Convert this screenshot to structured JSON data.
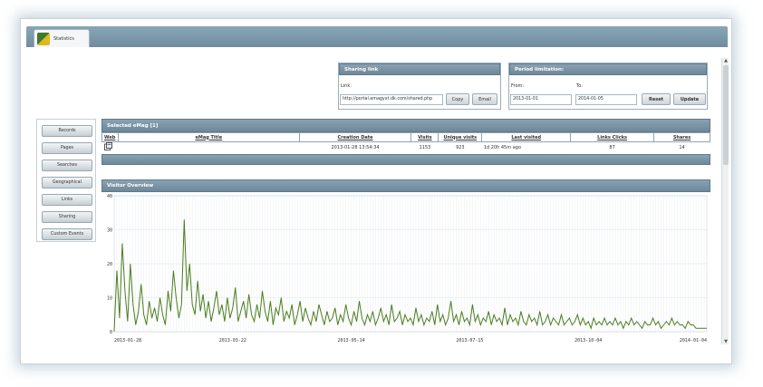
{
  "window": {
    "tab_label": "Statistics"
  },
  "sharing": {
    "title": "Sharing link",
    "link_label": "Link:",
    "link_value": "http://portal.emagyxt.dk.com/shared.php",
    "copy_label": "Copy",
    "email_label": "Email"
  },
  "period": {
    "title": "Period limitation:",
    "from_label": "From:",
    "to_label": "To:",
    "from_value": "2013-01-01",
    "to_value": "2014-01-05",
    "reset_label": "Reset",
    "update_label": "Update"
  },
  "sidebar": {
    "items": [
      {
        "label": "Records"
      },
      {
        "label": "Pages"
      },
      {
        "label": "Searches"
      },
      {
        "label": "Geographical"
      },
      {
        "label": "Links"
      },
      {
        "label": "Sharing"
      },
      {
        "label": "Custom Events"
      }
    ]
  },
  "selected": {
    "title": "Selected eMag [1]",
    "columns": [
      "Web",
      "eMag Title",
      "Creation Date",
      "Visits",
      "Unique visits",
      "Last visited",
      "Links Clicks",
      "Shares"
    ],
    "row": {
      "web_icon": "web-page-icon",
      "title": "",
      "creation_date": "2013-01-28 13:54:34",
      "visits": "1153",
      "unique_visits": "923",
      "last_visited": "1d 20h 45m ago",
      "link_clicks": "87",
      "shares": "14"
    }
  },
  "overview": {
    "title": "Visitor Overview"
  },
  "chart_data": {
    "type": "line",
    "title": "",
    "xlabel": "",
    "ylabel": "",
    "ylim": [
      0,
      40
    ],
    "yticks": [
      "0",
      "10",
      "20",
      "30",
      "40"
    ],
    "xticks": [
      "2013-01-28",
      "2013-03-22",
      "2013-05-14",
      "2013-07-15",
      "2013-10-04",
      "2014-01-04"
    ],
    "line_color": "#4a7d1f",
    "grid": true,
    "series": [
      {
        "values": [
          0,
          18,
          4,
          26,
          12,
          3,
          20,
          8,
          2,
          6,
          14,
          5,
          2,
          9,
          4,
          7,
          3,
          10,
          5,
          2,
          12,
          6,
          18,
          10,
          4,
          8,
          33,
          12,
          20,
          8,
          5,
          15,
          6,
          11,
          4,
          9,
          3,
          7,
          12,
          5,
          8,
          3,
          10,
          4,
          7,
          13,
          3,
          6,
          9,
          4,
          11,
          5,
          3,
          8,
          4,
          12,
          6,
          3,
          9,
          2,
          7,
          5,
          10,
          3,
          6,
          4,
          8,
          2,
          5,
          9,
          3,
          7,
          4,
          2,
          6,
          3,
          8,
          5,
          2,
          6,
          3,
          4,
          7,
          2,
          5,
          3,
          8,
          4,
          2,
          6,
          3,
          9,
          4,
          2,
          5,
          3,
          6,
          2,
          4,
          7,
          3,
          5,
          2,
          8,
          3,
          4,
          6,
          2,
          5,
          3,
          4,
          2,
          7,
          3,
          5,
          2,
          4,
          3,
          6,
          2,
          8,
          3,
          5,
          2,
          4,
          9,
          3,
          5,
          2,
          6,
          3,
          4,
          2,
          8,
          3,
          5,
          2,
          4,
          3,
          6,
          2,
          5,
          3,
          4,
          2,
          7,
          2,
          5,
          3,
          4,
          2,
          6,
          3,
          2,
          5,
          3,
          4,
          2,
          6,
          2,
          3,
          5,
          2,
          4,
          3,
          2,
          5,
          2,
          3,
          4,
          2,
          3,
          5,
          2,
          4,
          2,
          3,
          1,
          4,
          2,
          3,
          2,
          4,
          2,
          3,
          2,
          4,
          2,
          3,
          1,
          3,
          2,
          4,
          2,
          3,
          2,
          1,
          3,
          2,
          2,
          4,
          2,
          3,
          1,
          2,
          3,
          2,
          4,
          2,
          3,
          2,
          2,
          1,
          3,
          2,
          2,
          1,
          1,
          1,
          1,
          1
        ]
      }
    ]
  }
}
